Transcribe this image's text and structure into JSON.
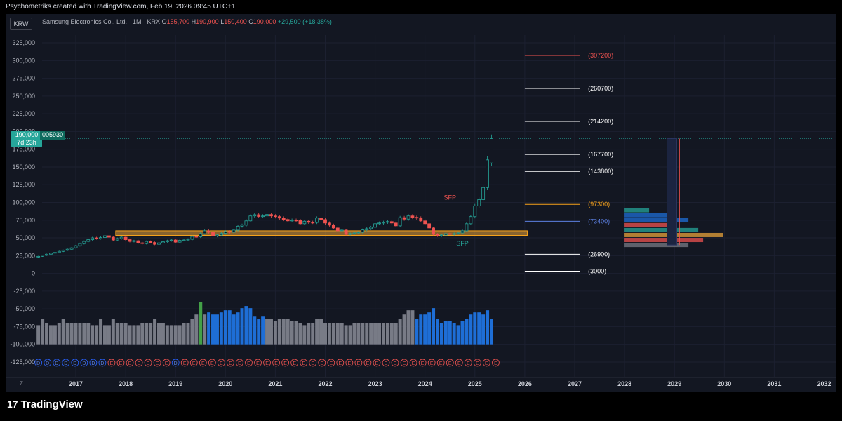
{
  "header": {
    "caption": "Psychometriks created with TradingView.com, Feb 19, 2026 09:45 UTC+1"
  },
  "symbol": {
    "currency": "KRW",
    "name": "Samsung Electronics Co., Ltd. · 1M · KRX",
    "o_label": "O",
    "o_value": "155,700",
    "h_label": "H",
    "h_value": "190,900",
    "l_label": "L",
    "l_value": "150,400",
    "c_label": "C",
    "c_value": "190,000",
    "change": "+29,500 (+18.38%)"
  },
  "price_badge": {
    "price": "190,000",
    "countdown": "7d 23h",
    "ticker": "005930"
  },
  "footer": {
    "logo_text": "TradingView",
    "logo_mark": "17",
    "zoom_label": "Z"
  },
  "colors": {
    "background": "#131722",
    "up": "#26a69a",
    "down": "#ef5350",
    "zone": "#e8a33a",
    "volume_blue": "#1e6ed6",
    "volume_grey": "#787b86"
  },
  "chart_data": {
    "type": "candlestick",
    "ylim": [
      -130000,
      330000
    ],
    "y_ticks": [
      {
        "v": 325000,
        "label": "325,000"
      },
      {
        "v": 300000,
        "label": "300,000"
      },
      {
        "v": 275000,
        "label": "275,000"
      },
      {
        "v": 250000,
        "label": "250,000"
      },
      {
        "v": 225000,
        "label": "225,000"
      },
      {
        "v": 200000,
        "label": "200,000"
      },
      {
        "v": 175000,
        "label": "175,000"
      },
      {
        "v": 150000,
        "label": "150,000"
      },
      {
        "v": 125000,
        "label": "125,000"
      },
      {
        "v": 100000,
        "label": "100,000"
      },
      {
        "v": 75000,
        "label": "75,000"
      },
      {
        "v": 50000,
        "label": "50,000"
      },
      {
        "v": 25000,
        "label": "25,000"
      },
      {
        "v": 0,
        "label": "0"
      },
      {
        "v": -25000,
        "label": "-25,000"
      },
      {
        "v": -50000,
        "label": "-50,000"
      },
      {
        "v": -75000,
        "label": "-75,000"
      },
      {
        "v": -100000,
        "label": "-100,000"
      },
      {
        "v": -125000,
        "label": "-125,000"
      }
    ],
    "x_ticks": [
      "2017",
      "2018",
      "2019",
      "2020",
      "2021",
      "2022",
      "2023",
      "2024",
      "2025",
      "2026",
      "2027",
      "2028",
      "2029",
      "2030",
      "2031",
      "2032"
    ],
    "x_start_year": 2016.25,
    "candles_close": [
      24000,
      25500,
      27000,
      28500,
      29500,
      31000,
      32500,
      34000,
      36000,
      39000,
      42000,
      45000,
      47500,
      50000,
      49000,
      50500,
      53000,
      51000,
      47000,
      49000,
      51000,
      47500,
      45000,
      46000,
      43000,
      42000,
      45000,
      43500,
      41000,
      43000,
      44500,
      46000,
      47000,
      44000,
      46500,
      47000,
      48000,
      52000,
      51500,
      56000,
      60000,
      58000,
      52500,
      54000,
      56500,
      59000,
      58000,
      61000,
      66500,
      68000,
      74000,
      81000,
      82700,
      80200,
      81000,
      83000,
      81000,
      80000,
      78000,
      76000,
      74000,
      75000,
      74500,
      70000,
      73500,
      72000,
      71800,
      78000,
      75800,
      71000,
      68000,
      64000,
      60000,
      61000,
      55000,
      56000,
      57000,
      58000,
      61300,
      63000,
      65000,
      70000,
      71000,
      72000,
      73000,
      71000,
      67000,
      78600,
      76500,
      81000,
      79000,
      78000,
      74000,
      70000,
      64000,
      55000,
      53000,
      54000,
      56000,
      55000,
      56000,
      57000,
      60000,
      70000,
      80000,
      95000,
      104000,
      121000,
      160000,
      190000
    ],
    "candles_open": [
      23000,
      24000,
      25500,
      27000,
      28500,
      29500,
      31000,
      32500,
      34000,
      36000,
      39000,
      42000,
      45000,
      47500,
      50000,
      49000,
      50500,
      53000,
      51000,
      47000,
      49000,
      51000,
      47500,
      45000,
      46000,
      43000,
      42000,
      45000,
      43500,
      41000,
      43000,
      44500,
      46000,
      47000,
      44000,
      46500,
      47000,
      48000,
      52000,
      51500,
      56000,
      60000,
      58000,
      52500,
      54000,
      56500,
      59000,
      58000,
      61000,
      66500,
      68000,
      74000,
      81000,
      82700,
      80200,
      81000,
      83000,
      81000,
      80000,
      78000,
      76000,
      74000,
      75000,
      74500,
      70000,
      73500,
      72000,
      71800,
      78000,
      75800,
      71000,
      68000,
      64000,
      60000,
      61000,
      55000,
      56000,
      57000,
      58000,
      61300,
      63000,
      65000,
      70000,
      71000,
      72000,
      73000,
      71000,
      67000,
      78600,
      76500,
      81000,
      79000,
      78000,
      74000,
      70000,
      64000,
      55000,
      53000,
      54000,
      56000,
      55000,
      56000,
      57000,
      60000,
      70000,
      80000,
      95000,
      104000,
      121000,
      155700
    ],
    "levels": [
      {
        "value": 307200,
        "label": "(307200)",
        "color": "#ef5350"
      },
      {
        "value": 260700,
        "label": "(260700)",
        "color": "#ffffff"
      },
      {
        "value": 214200,
        "label": "(214200)",
        "color": "#ffffff"
      },
      {
        "value": 167700,
        "label": "(167700)",
        "color": "#ffffff"
      },
      {
        "value": 143800,
        "label": "(143800)",
        "color": "#ffffff"
      },
      {
        "value": 97300,
        "label": "(97300)",
        "color": "#f7a21b"
      },
      {
        "value": 73400,
        "label": "(73400)",
        "color": "#5b7fe0"
      },
      {
        "value": 26900,
        "label": "(26900)",
        "color": "#ffffff"
      },
      {
        "value": 3000,
        "label": "(3000)",
        "color": "#ffffff"
      }
    ],
    "annotations": [
      {
        "text": "SFP",
        "color": "#ef5350"
      },
      {
        "text": "SFP",
        "color": "#26a69a"
      }
    ],
    "event_markers": [
      "D",
      "D",
      "D",
      "D",
      "D",
      "D",
      "D",
      "D",
      "E",
      "E",
      "E",
      "E",
      "E",
      "E",
      "E",
      "D",
      "E",
      "E",
      "E",
      "E",
      "E",
      "E",
      "E",
      "E",
      "E",
      "E",
      "E",
      "E",
      "E",
      "E",
      "E",
      "E",
      "E",
      "E",
      "E",
      "E",
      "E",
      "E",
      "E",
      "E",
      "E",
      "E",
      "E",
      "E",
      "E",
      "E",
      "E",
      "E",
      "E",
      "E",
      "E"
    ],
    "volume": [
      0.45,
      0.6,
      0.5,
      0.45,
      0.45,
      0.5,
      0.6,
      0.5,
      0.5,
      0.5,
      0.5,
      0.5,
      0.5,
      0.45,
      0.45,
      0.6,
      0.45,
      0.45,
      0.6,
      0.5,
      0.5,
      0.5,
      0.45,
      0.45,
      0.45,
      0.5,
      0.5,
      0.5,
      0.6,
      0.5,
      0.5,
      0.45,
      0.45,
      0.45,
      0.45,
      0.5,
      0.5,
      0.6,
      0.7,
      1.0,
      0.7,
      0.75,
      0.7,
      0.7,
      0.75,
      0.8,
      0.8,
      0.7,
      0.75,
      0.85,
      0.9,
      0.85,
      0.65,
      0.6,
      0.65,
      0.6,
      0.6,
      0.55,
      0.6,
      0.6,
      0.6,
      0.55,
      0.55,
      0.5,
      0.45,
      0.5,
      0.5,
      0.6,
      0.6,
      0.5,
      0.5,
      0.5,
      0.5,
      0.5,
      0.45,
      0.45,
      0.5,
      0.5,
      0.5,
      0.5,
      0.5,
      0.5,
      0.5,
      0.5,
      0.5,
      0.5,
      0.5,
      0.6,
      0.7,
      0.8,
      0.8,
      0.6,
      0.7,
      0.7,
      0.75,
      0.85,
      0.6,
      0.5,
      0.55,
      0.55,
      0.5,
      0.45,
      0.55,
      0.6,
      0.7,
      0.75,
      0.75,
      0.7,
      0.8,
      0.6
    ]
  }
}
